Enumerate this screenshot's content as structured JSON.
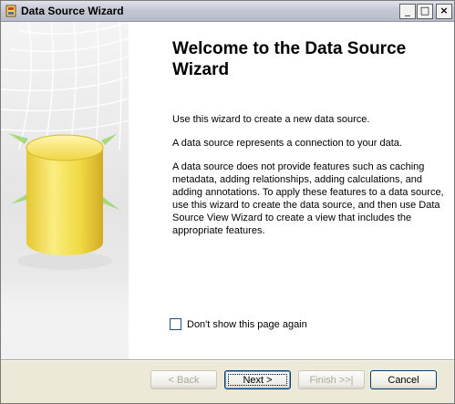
{
  "window": {
    "title": "Data Source Wizard",
    "controls": {
      "minimize_label": "_",
      "maximize_label": "□",
      "close_label": "×"
    }
  },
  "page": {
    "heading": "Welcome to the Data Source Wizard",
    "paragraphs": [
      "Use this wizard to create a new data source.",
      "A data source represents a connection to your data.",
      "A data source does not provide features such as caching metadata, adding relationships, adding calculations, and adding annotations. To apply these features to a data source, use this wizard to create the data source, and then use Data Source View Wizard to create a view that includes the appropriate features."
    ],
    "checkbox_label": "Don't show this page again",
    "checkbox_checked": false
  },
  "buttons": {
    "back_label": "< Back",
    "next_label": "Next >",
    "finish_label": "Finish >>|",
    "cancel_label": "Cancel"
  },
  "icons": {
    "app": "wizard-app-icon",
    "side_art": "yellow-database-cylinder-icon"
  },
  "colors": {
    "art_cylinder": "#f2d93a",
    "art_arrow": "#9cd66b",
    "disabled_text": "#aca899"
  }
}
